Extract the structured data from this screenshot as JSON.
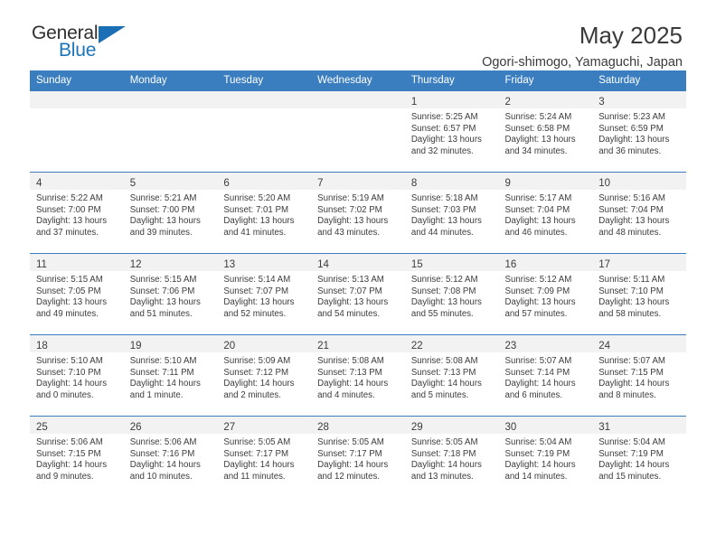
{
  "brand": {
    "name_top": "General",
    "name_bottom": "Blue",
    "accent_color": "#1b75bc"
  },
  "header": {
    "title": "May 2025",
    "subtitle": "Ogori-shimogo, Yamaguchi, Japan"
  },
  "calendar": {
    "header_color": "#3a7ebf",
    "weekday_headers": [
      "Sunday",
      "Monday",
      "Tuesday",
      "Wednesday",
      "Thursday",
      "Friday",
      "Saturday"
    ],
    "weeks": [
      [
        {
          "day": "",
          "lines": []
        },
        {
          "day": "",
          "lines": []
        },
        {
          "day": "",
          "lines": []
        },
        {
          "day": "",
          "lines": []
        },
        {
          "day": "1",
          "lines": [
            "Sunrise: 5:25 AM",
            "Sunset: 6:57 PM",
            "Daylight: 13 hours",
            "and 32 minutes."
          ]
        },
        {
          "day": "2",
          "lines": [
            "Sunrise: 5:24 AM",
            "Sunset: 6:58 PM",
            "Daylight: 13 hours",
            "and 34 minutes."
          ]
        },
        {
          "day": "3",
          "lines": [
            "Sunrise: 5:23 AM",
            "Sunset: 6:59 PM",
            "Daylight: 13 hours",
            "and 36 minutes."
          ]
        }
      ],
      [
        {
          "day": "4",
          "lines": [
            "Sunrise: 5:22 AM",
            "Sunset: 7:00 PM",
            "Daylight: 13 hours",
            "and 37 minutes."
          ]
        },
        {
          "day": "5",
          "lines": [
            "Sunrise: 5:21 AM",
            "Sunset: 7:00 PM",
            "Daylight: 13 hours",
            "and 39 minutes."
          ]
        },
        {
          "day": "6",
          "lines": [
            "Sunrise: 5:20 AM",
            "Sunset: 7:01 PM",
            "Daylight: 13 hours",
            "and 41 minutes."
          ]
        },
        {
          "day": "7",
          "lines": [
            "Sunrise: 5:19 AM",
            "Sunset: 7:02 PM",
            "Daylight: 13 hours",
            "and 43 minutes."
          ]
        },
        {
          "day": "8",
          "lines": [
            "Sunrise: 5:18 AM",
            "Sunset: 7:03 PM",
            "Daylight: 13 hours",
            "and 44 minutes."
          ]
        },
        {
          "day": "9",
          "lines": [
            "Sunrise: 5:17 AM",
            "Sunset: 7:04 PM",
            "Daylight: 13 hours",
            "and 46 minutes."
          ]
        },
        {
          "day": "10",
          "lines": [
            "Sunrise: 5:16 AM",
            "Sunset: 7:04 PM",
            "Daylight: 13 hours",
            "and 48 minutes."
          ]
        }
      ],
      [
        {
          "day": "11",
          "lines": [
            "Sunrise: 5:15 AM",
            "Sunset: 7:05 PM",
            "Daylight: 13 hours",
            "and 49 minutes."
          ]
        },
        {
          "day": "12",
          "lines": [
            "Sunrise: 5:15 AM",
            "Sunset: 7:06 PM",
            "Daylight: 13 hours",
            "and 51 minutes."
          ]
        },
        {
          "day": "13",
          "lines": [
            "Sunrise: 5:14 AM",
            "Sunset: 7:07 PM",
            "Daylight: 13 hours",
            "and 52 minutes."
          ]
        },
        {
          "day": "14",
          "lines": [
            "Sunrise: 5:13 AM",
            "Sunset: 7:07 PM",
            "Daylight: 13 hours",
            "and 54 minutes."
          ]
        },
        {
          "day": "15",
          "lines": [
            "Sunrise: 5:12 AM",
            "Sunset: 7:08 PM",
            "Daylight: 13 hours",
            "and 55 minutes."
          ]
        },
        {
          "day": "16",
          "lines": [
            "Sunrise: 5:12 AM",
            "Sunset: 7:09 PM",
            "Daylight: 13 hours",
            "and 57 minutes."
          ]
        },
        {
          "day": "17",
          "lines": [
            "Sunrise: 5:11 AM",
            "Sunset: 7:10 PM",
            "Daylight: 13 hours",
            "and 58 minutes."
          ]
        }
      ],
      [
        {
          "day": "18",
          "lines": [
            "Sunrise: 5:10 AM",
            "Sunset: 7:10 PM",
            "Daylight: 14 hours",
            "and 0 minutes."
          ]
        },
        {
          "day": "19",
          "lines": [
            "Sunrise: 5:10 AM",
            "Sunset: 7:11 PM",
            "Daylight: 14 hours",
            "and 1 minute."
          ]
        },
        {
          "day": "20",
          "lines": [
            "Sunrise: 5:09 AM",
            "Sunset: 7:12 PM",
            "Daylight: 14 hours",
            "and 2 minutes."
          ]
        },
        {
          "day": "21",
          "lines": [
            "Sunrise: 5:08 AM",
            "Sunset: 7:13 PM",
            "Daylight: 14 hours",
            "and 4 minutes."
          ]
        },
        {
          "day": "22",
          "lines": [
            "Sunrise: 5:08 AM",
            "Sunset: 7:13 PM",
            "Daylight: 14 hours",
            "and 5 minutes."
          ]
        },
        {
          "day": "23",
          "lines": [
            "Sunrise: 5:07 AM",
            "Sunset: 7:14 PM",
            "Daylight: 14 hours",
            "and 6 minutes."
          ]
        },
        {
          "day": "24",
          "lines": [
            "Sunrise: 5:07 AM",
            "Sunset: 7:15 PM",
            "Daylight: 14 hours",
            "and 8 minutes."
          ]
        }
      ],
      [
        {
          "day": "25",
          "lines": [
            "Sunrise: 5:06 AM",
            "Sunset: 7:15 PM",
            "Daylight: 14 hours",
            "and 9 minutes."
          ]
        },
        {
          "day": "26",
          "lines": [
            "Sunrise: 5:06 AM",
            "Sunset: 7:16 PM",
            "Daylight: 14 hours",
            "and 10 minutes."
          ]
        },
        {
          "day": "27",
          "lines": [
            "Sunrise: 5:05 AM",
            "Sunset: 7:17 PM",
            "Daylight: 14 hours",
            "and 11 minutes."
          ]
        },
        {
          "day": "28",
          "lines": [
            "Sunrise: 5:05 AM",
            "Sunset: 7:17 PM",
            "Daylight: 14 hours",
            "and 12 minutes."
          ]
        },
        {
          "day": "29",
          "lines": [
            "Sunrise: 5:05 AM",
            "Sunset: 7:18 PM",
            "Daylight: 14 hours",
            "and 13 minutes."
          ]
        },
        {
          "day": "30",
          "lines": [
            "Sunrise: 5:04 AM",
            "Sunset: 7:19 PM",
            "Daylight: 14 hours",
            "and 14 minutes."
          ]
        },
        {
          "day": "31",
          "lines": [
            "Sunrise: 5:04 AM",
            "Sunset: 7:19 PM",
            "Daylight: 14 hours",
            "and 15 minutes."
          ]
        }
      ]
    ]
  }
}
